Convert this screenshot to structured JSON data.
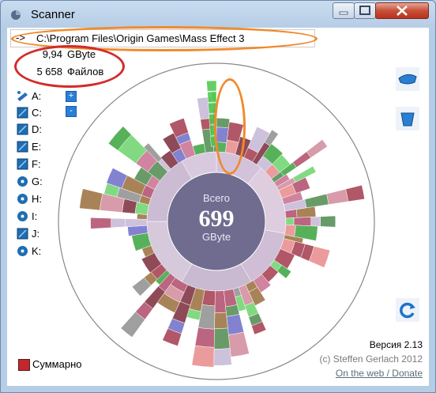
{
  "window": {
    "title": "Scanner"
  },
  "path": {
    "arrow": "->",
    "text": "C:\\Program Files\\Origin Games\\Mass Effect 3"
  },
  "info": {
    "size_value": "9,94",
    "size_unit": "GByte",
    "files_value": "5 658",
    "files_unit": "Файлов"
  },
  "drives": [
    "A:",
    "C:",
    "D:",
    "E:",
    "F:",
    "G:",
    "H:",
    "I:",
    "J:",
    "K:"
  ],
  "zoom": {
    "plus": "+",
    "minus": "-"
  },
  "center": {
    "label": "Всего",
    "value": "699",
    "unit": "GByte"
  },
  "footer": {
    "version": "Версия 2.13",
    "copyright": "(c) Steffen Gerlach 2012",
    "link": "On the web / Donate",
    "summary": "Суммарно"
  },
  "colors": {
    "orange": "#f08a2c",
    "red": "#d32b2b",
    "center": "#6f6c8f"
  }
}
